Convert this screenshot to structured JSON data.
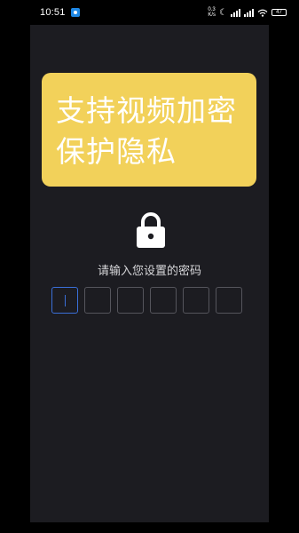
{
  "status_bar": {
    "time": "10:51",
    "network_speed_top": "0.3",
    "network_speed_bottom": "K/s",
    "battery": "47",
    "icons": [
      "app-notification-icon",
      "moon-icon",
      "signal-icon",
      "wifi-icon",
      "battery-icon"
    ]
  },
  "promo": {
    "line1": "支持视频加密",
    "line2": "保护隐私",
    "background": "#f2d15a"
  },
  "lock": {
    "icon": "lock-icon"
  },
  "prompt": "请输入您设置的密码",
  "pin": {
    "length": 6,
    "filled": 0,
    "accent": "#3a6fd8"
  },
  "colors": {
    "screen_bg": "#1c1c21",
    "page_bg": "#000000"
  }
}
